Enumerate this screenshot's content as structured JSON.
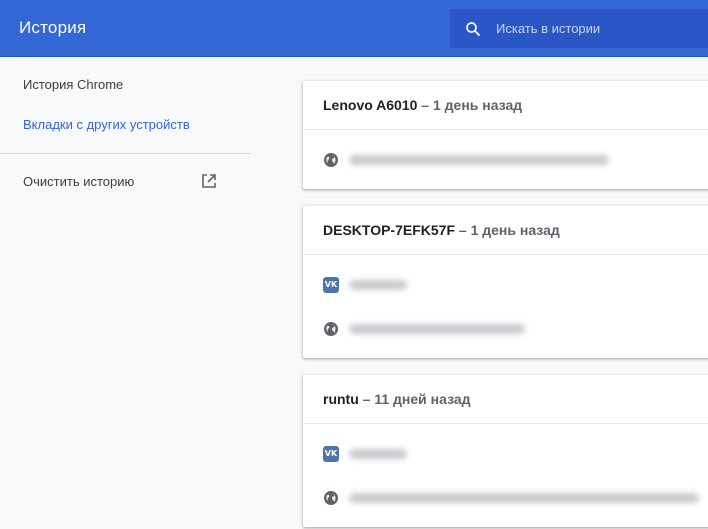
{
  "header": {
    "title": "История",
    "search_placeholder": "Искать в истории"
  },
  "sidebar": {
    "items": [
      {
        "label": "История Chrome"
      },
      {
        "label": "Вкладки с других устройств"
      }
    ],
    "clear_label": "Очистить историю"
  },
  "devices": [
    {
      "name": "Lenovo A6010",
      "separator": " – ",
      "when": "1 день назад",
      "entries": [
        {
          "icon": "globe-icon"
        }
      ]
    },
    {
      "name": "DESKTOP-7EFK57F",
      "separator": " – ",
      "when": "1 день назад",
      "entries": [
        {
          "icon": "vk-icon",
          "glyph": "VK"
        },
        {
          "icon": "globe-icon"
        }
      ]
    },
    {
      "name": "runtu",
      "separator": " – ",
      "when": "11 дней назад",
      "entries": [
        {
          "icon": "vk-icon",
          "glyph": "VK"
        },
        {
          "icon": "globe-icon"
        }
      ]
    }
  ],
  "colors": {
    "accent": "#3367d6",
    "search_bg": "#2a56c6",
    "vk": "#4a76a8"
  }
}
